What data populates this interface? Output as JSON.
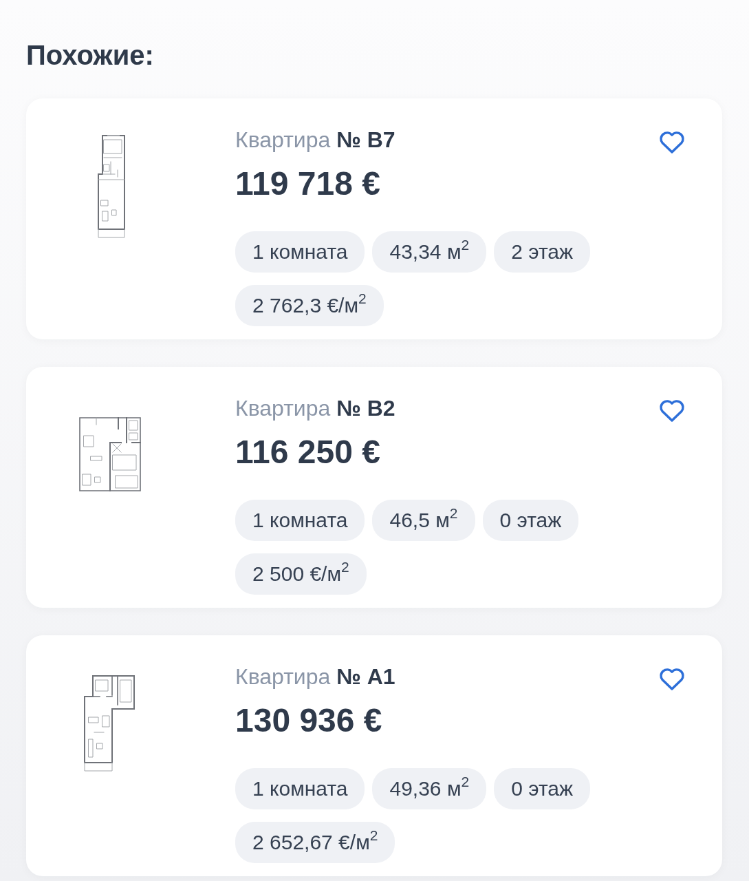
{
  "heading": "Похожие:",
  "listings": [
    {
      "kind": "narrow",
      "title": "Квартира **№ B7**",
      "price": "119 718 €",
      "favorite": false,
      "tags": [
        "1 комната",
        "43,34 м$^{2}$",
        "2 этаж",
        "2 762,3 €/м$^{2}$"
      ]
    },
    {
      "kind": "wide",
      "title": "Квартира **№ B2**",
      "price": "116 250 €",
      "favorite": false,
      "tags": [
        "1 комната",
        "46,5 м$^{2}$",
        "0 этаж",
        "2 500 €/м$^{2}$"
      ]
    },
    {
      "kind": "angled",
      "title": "Квартира **№ A1**",
      "price": "130 936 €",
      "favorite": false,
      "tags": [
        "1 комната",
        "49,36 м$^{2}$",
        "0 этаж",
        "2 652,67 €/м$^{2}$"
      ]
    }
  ]
}
